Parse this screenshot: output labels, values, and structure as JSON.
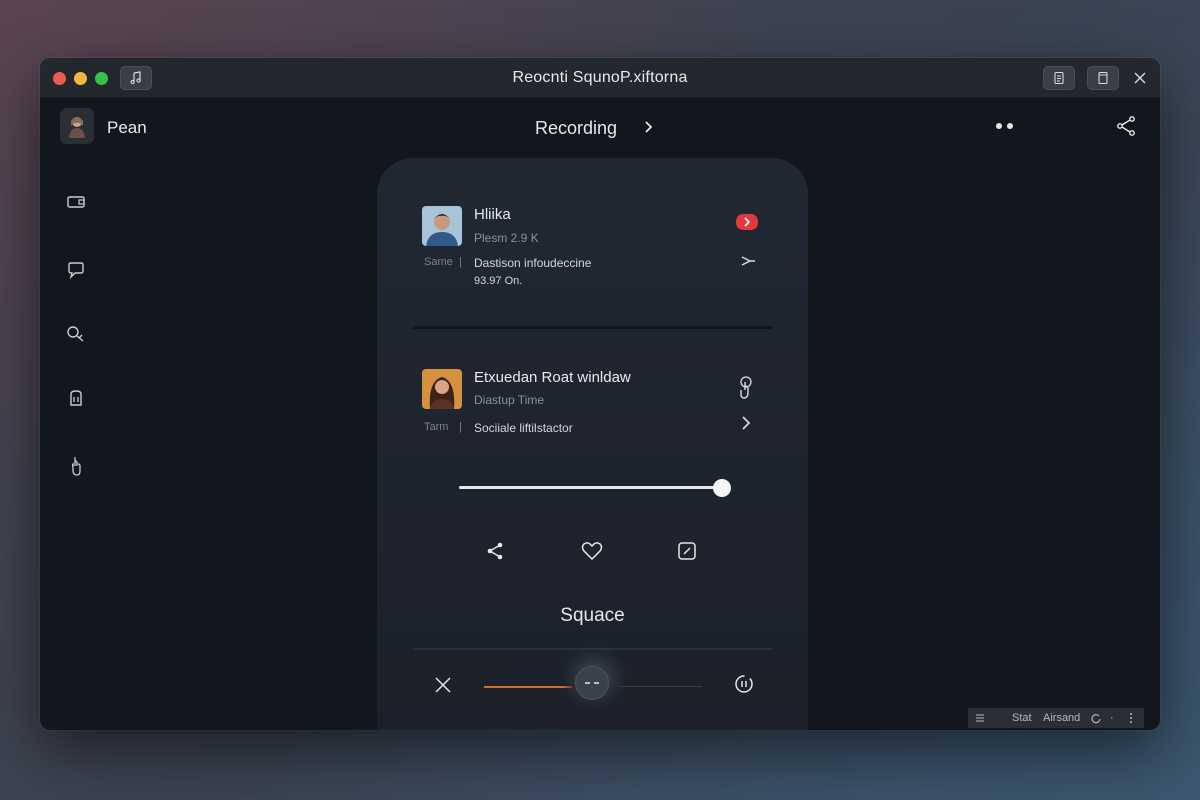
{
  "window": {
    "title": "Reocnti SqunoP.xiftorna"
  },
  "topbar": {
    "user_name": "Pean",
    "center_title": "Recording"
  },
  "sidebar": {
    "items": [
      {
        "icon": "wallet-icon"
      },
      {
        "icon": "chat-bubble-icon"
      },
      {
        "icon": "search-tag-icon"
      },
      {
        "icon": "door-icon"
      },
      {
        "icon": "hand-pointer-icon"
      }
    ]
  },
  "items": [
    {
      "title": "Hliika",
      "subtitle": "Plesm 2.9 K",
      "meta_label": "Same",
      "meta_sep": "|",
      "description": "Dastison infoudeccine",
      "detail": "93.97 On."
    },
    {
      "title": "Etxuedan Roat winldaw",
      "subtitle": "Diastup Time",
      "meta_label": "Tarm",
      "meta_sep": "|",
      "description": "Sociiale liftilstactor"
    }
  ],
  "player": {
    "slider_value": 0.98,
    "label": "Squace",
    "progress": 0.5
  },
  "statusbar": {
    "label1": "Stat",
    "label2": "Airsand"
  },
  "colors": {
    "accent": "#d56a3a",
    "record": "#e0393e",
    "background": "#12161d"
  }
}
